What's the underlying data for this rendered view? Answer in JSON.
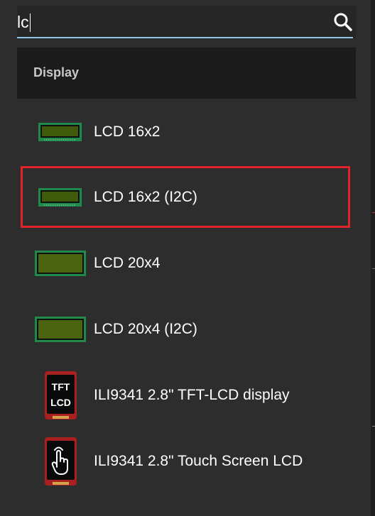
{
  "search": {
    "value": "lc",
    "icon": "search-icon"
  },
  "category": {
    "label": "Display"
  },
  "items": [
    {
      "label": "LCD 16x2",
      "icon": "lcd-16x2-icon"
    },
    {
      "label": "LCD 16x2 (I2C)",
      "icon": "lcd-16x2-i2c-icon",
      "selected": true
    },
    {
      "label": "LCD 20x4",
      "icon": "lcd-20x4-icon"
    },
    {
      "label": "LCD 20x4 (I2C)",
      "icon": "lcd-20x4-i2c-icon"
    },
    {
      "label": "ILI9341 2.8\" TFT-LCD display",
      "icon": "tft-lcd-icon",
      "icon_text": [
        "TFT",
        "LCD"
      ]
    },
    {
      "label": "ILI9341 2.8\" Touch Screen LCD",
      "icon": "touch-screen-icon"
    }
  ],
  "colors": {
    "selection_border": "#e0242a",
    "search_underline": "#8fc3e8",
    "lcd_screen": "#3f5a0a",
    "lcd_board": "#1f8a4c"
  }
}
